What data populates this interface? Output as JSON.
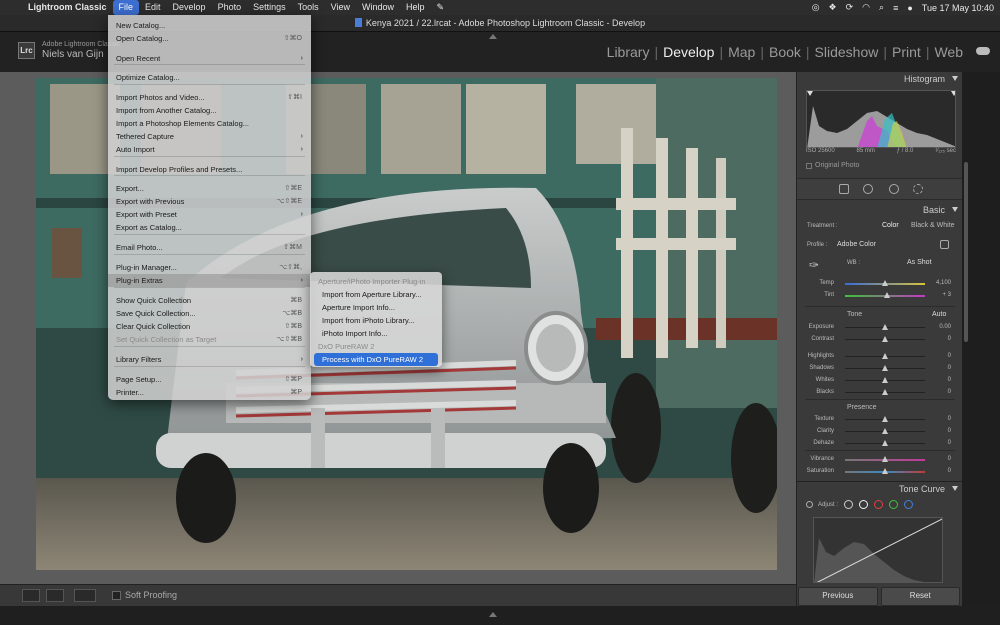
{
  "macbar": {
    "app": "Lightroom Classic",
    "menus": [
      "File",
      "Edit",
      "Develop",
      "Photo",
      "Settings",
      "Tools",
      "View",
      "Window",
      "Help"
    ],
    "datetime": "Tue 17 May  10:40"
  },
  "window_title": "Kenya 2021 / 22.lrcat - Adobe Photoshop Lightroom Classic - Develop",
  "identity": {
    "small": "Adobe Lightroom Classic",
    "name": "Niels van Gijn",
    "logo": "Lrc"
  },
  "modules": [
    "Library",
    "Develop",
    "Map",
    "Book",
    "Slideshow",
    "Print",
    "Web"
  ],
  "active_module": "Develop",
  "file_menu": {
    "items": [
      {
        "label": "New Catalog...",
        "shortcut": ""
      },
      {
        "label": "Open Catalog...",
        "shortcut": "⇧⌘O"
      },
      {
        "label": "Open Recent",
        "shortcut": "",
        "sub": "›"
      },
      {
        "label": "Optimize Catalog...",
        "shortcut": ""
      },
      {
        "label": "Import Photos and Video...",
        "shortcut": "⇧⌘I"
      },
      {
        "label": "Import from Another Catalog...",
        "shortcut": ""
      },
      {
        "label": "Import a Photoshop Elements Catalog...",
        "shortcut": ""
      },
      {
        "label": "Tethered Capture",
        "shortcut": "",
        "sub": "›"
      },
      {
        "label": "Auto Import",
        "shortcut": "",
        "sub": "›"
      },
      {
        "label": "Import Develop Profiles and Presets...",
        "shortcut": ""
      },
      {
        "label": "Export...",
        "shortcut": "⇧⌘E"
      },
      {
        "label": "Export with Previous",
        "shortcut": "⌥⇧⌘E"
      },
      {
        "label": "Export with Preset",
        "shortcut": "",
        "sub": "›"
      },
      {
        "label": "Export as Catalog...",
        "shortcut": ""
      },
      {
        "label": "Email Photo...",
        "shortcut": "⇧⌘M"
      },
      {
        "label": "Plug-in Manager...",
        "shortcut": "⌥⇧⌘,"
      },
      {
        "label": "Plug-in Extras",
        "shortcut": "",
        "sub": "›"
      },
      {
        "label": "Show Quick Collection",
        "shortcut": "⌘B"
      },
      {
        "label": "Save Quick Collection...",
        "shortcut": "⌥⌘B"
      },
      {
        "label": "Clear Quick Collection",
        "shortcut": "⇧⌘B"
      },
      {
        "label": "Set Quick Collection as Target",
        "shortcut": "⌥⇧⌘B"
      },
      {
        "label": "Library Filters",
        "shortcut": "",
        "sub": "›"
      },
      {
        "label": "Page Setup...",
        "shortcut": "⇧⌘P"
      },
      {
        "label": "Printer...",
        "shortcut": "⌘P"
      }
    ]
  },
  "submenu": {
    "items": [
      {
        "label": "Aperture/iPhoto Importer Plug-in"
      },
      {
        "label": "Import from Aperture Library..."
      },
      {
        "label": "Aperture Import Info..."
      },
      {
        "label": "Import from iPhoto Library..."
      },
      {
        "label": "iPhoto Import Info..."
      },
      {
        "label": "DxO PureRAW 2"
      },
      {
        "label": "Process with DxO PureRAW 2"
      }
    ]
  },
  "toolbar": {
    "soft_proofing": "Soft Proofing"
  },
  "right_panel": {
    "histogram_title": "Histogram",
    "hist_info": [
      "ISO 25600",
      "85 mm",
      "ƒ / 8.0",
      "¹⁄₁₂₅ sec"
    ],
    "original_photo": "Original Photo",
    "basic_title": "Basic",
    "treatment_label": "Treatment :",
    "treatment_color": "Color",
    "treatment_bw": "Black & White",
    "profile_label": "Profile :",
    "profile_value": "Adobe Color",
    "wb_label": "WB :",
    "wb_value": "As Shot",
    "tone_label": "Tone",
    "tone_auto": "Auto",
    "presence_label": "Presence",
    "tone_curve_title": "Tone Curve",
    "adjust_label": "Adjust :",
    "sliders": [
      {
        "label": "Temp",
        "value": "4,100"
      },
      {
        "label": "Tint",
        "value": "+ 3"
      },
      {
        "label": "Exposure",
        "value": "0.00"
      },
      {
        "label": "Contrast",
        "value": "0"
      },
      {
        "label": "Highlights",
        "value": "0"
      },
      {
        "label": "Shadows",
        "value": "0"
      },
      {
        "label": "Whites",
        "value": "0"
      },
      {
        "label": "Blacks",
        "value": "0"
      },
      {
        "label": "Texture",
        "value": "0"
      },
      {
        "label": "Clarity",
        "value": "0"
      },
      {
        "label": "Dehaze",
        "value": "0"
      },
      {
        "label": "Vibrance",
        "value": "0"
      },
      {
        "label": "Saturation",
        "value": "0"
      }
    ],
    "previous_label": "Previous",
    "reset_label": "Reset"
  }
}
